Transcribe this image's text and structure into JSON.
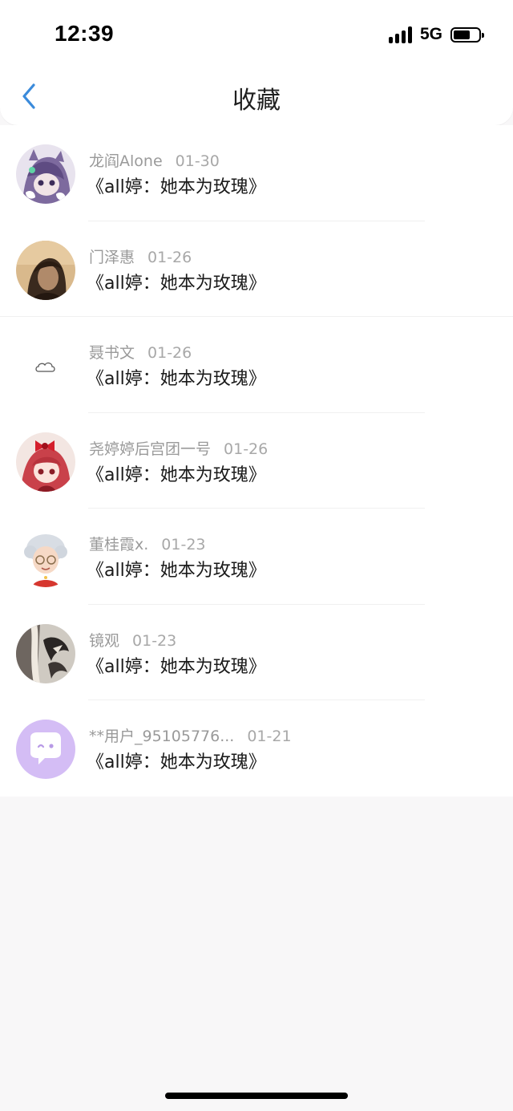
{
  "status_bar": {
    "time": "12:39",
    "network": "5G",
    "battery_level": 0.6
  },
  "header": {
    "title": "收藏",
    "back_icon": "chevron-left-icon",
    "accent_color": "#3b8bdb"
  },
  "favorites": [
    {
      "name": "龙阎Alone",
      "date": "01-30",
      "content": "《all婷：她本为玫瑰》",
      "avatar": "anime-purple-avatar"
    },
    {
      "name": "门泽惠",
      "date": "01-26",
      "content": "《all婷：她本为玫瑰》",
      "avatar": "photo-person-avatar"
    },
    {
      "name": "聂书文",
      "date": "01-26",
      "content": "《all婷：她本为玫瑰》",
      "avatar": "cloud-icon"
    },
    {
      "name": "尧婷婷后宫团一号",
      "date": "01-26",
      "content": "《all婷：她本为玫瑰》",
      "avatar": "anime-red-bow-avatar"
    },
    {
      "name": "董桂霞x.",
      "date": "01-23",
      "content": "《all婷：她本为玫瑰》",
      "avatar": "cartoon-grandma-avatar"
    },
    {
      "name": "镜观",
      "date": "01-23",
      "content": "《all婷：她本为玫瑰》",
      "avatar": "dark-art-avatar"
    },
    {
      "name": "**用户_95105776...",
      "date": "01-21",
      "content": "《all婷：她本为玫瑰》",
      "avatar": "chat-bubble-default-avatar"
    }
  ]
}
